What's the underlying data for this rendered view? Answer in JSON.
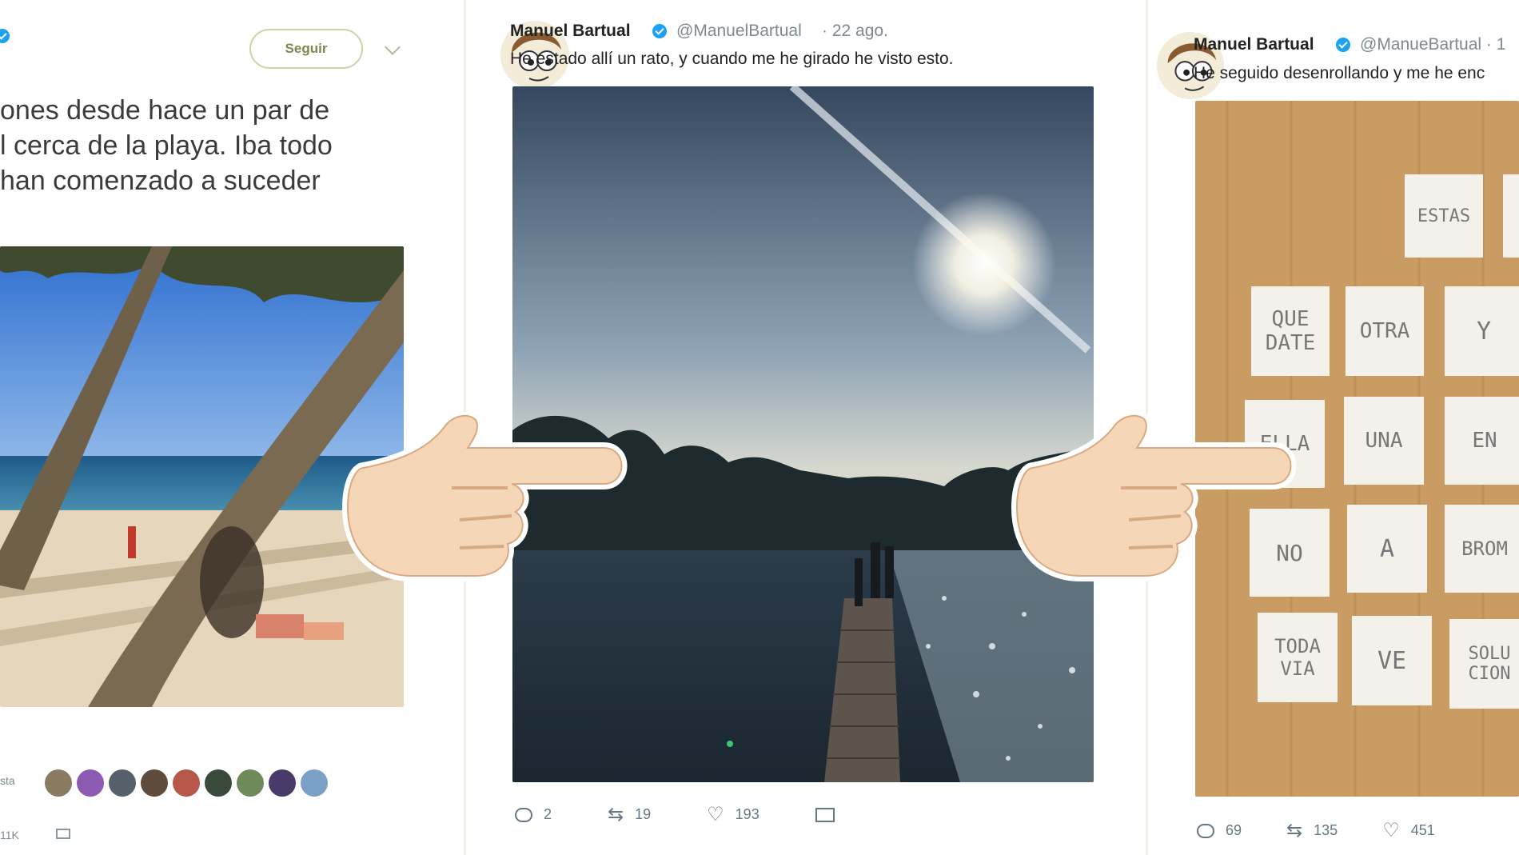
{
  "left_tweet": {
    "follow_label": "Seguir",
    "text_lines": [
      "ones desde hace un par de",
      "l cerca de la playa. Iba todo",
      "han comenzado a suceder"
    ],
    "likes_label": "sta",
    "count_label": "11K"
  },
  "center_tweet": {
    "author": "Manuel Bartual",
    "handle": "@ManuelBartual",
    "date": "· 22 ago.",
    "text": "He estado allí un rato, y cuando me he girado he visto esto.",
    "replies": "2",
    "retweets": "19",
    "likes": "193"
  },
  "right_tweet": {
    "author": "Manuel Bartual",
    "handle": "@ManueBartual · 1",
    "text": "He seguido desenrollando y me he enc",
    "replies": "69",
    "retweets": "135",
    "likes": "451",
    "notes": [
      "ESTAS",
      "QUE DATE",
      "OTRA",
      "Y",
      "ELLA",
      "UNA",
      "EN",
      "NO",
      "A",
      "BROM",
      "TODA VIA",
      "VE",
      "SOLU CION"
    ]
  },
  "colors": {
    "verified": "#1da1f2",
    "divider": "#eef1e4",
    "muted": "#657786"
  }
}
